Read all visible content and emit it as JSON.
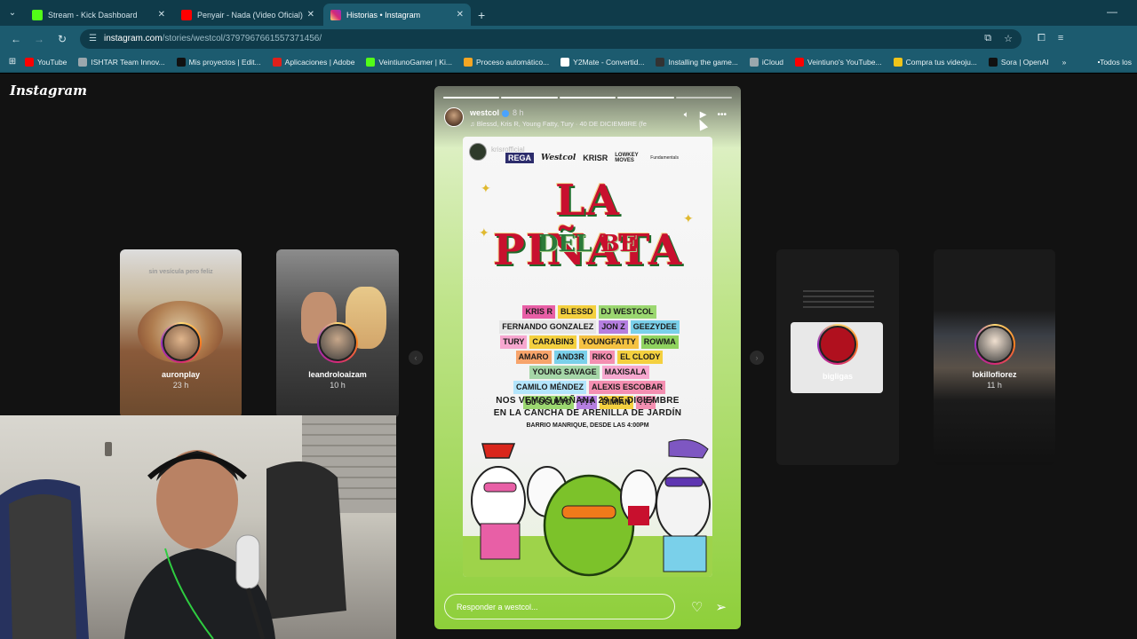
{
  "browser": {
    "tabs": [
      {
        "title": "Stream - Kick Dashboard",
        "color": "#53fc18",
        "active": false
      },
      {
        "title": "Penyair - Nada (Video Oficial) -",
        "color": "#ff0000",
        "active": false
      },
      {
        "title": "Historias • Instagram",
        "color": "#d62976",
        "active": true
      }
    ],
    "url_host": "instagram.com",
    "url_path": "/stories/westcol/3797967661557371456/",
    "bookmarks": [
      {
        "label": "YouTube",
        "color": "#ff0000"
      },
      {
        "label": "ISHTAR Team Innov...",
        "color": "#9aa7ad"
      },
      {
        "label": "Mis proyectos | Edit...",
        "color": "#111111"
      },
      {
        "label": "Aplicaciones | Adobe",
        "color": "#e0201b"
      },
      {
        "label": "VeintiunoGamer | Ki...",
        "color": "#53fc18"
      },
      {
        "label": "Proceso automático...",
        "color": "#f5a623"
      },
      {
        "label": "Y2Mate - Convertid...",
        "color": "#ffffff"
      },
      {
        "label": "Installing the game...",
        "color": "#333333"
      },
      {
        "label": "iCloud",
        "color": "#9aa7ad"
      },
      {
        "label": "Veintiuno's YouTube...",
        "color": "#ff0000"
      },
      {
        "label": "Compra tus videoju...",
        "color": "#f0c419"
      },
      {
        "label": "Sora | OpenAI",
        "color": "#111111"
      }
    ],
    "all_bookmarks": "Todos los"
  },
  "instagram": {
    "logo": "Instagram",
    "side_stories": [
      {
        "name": "auronplay",
        "time": "23 h"
      },
      {
        "name": "leandroloaizam",
        "time": "10 h"
      },
      {
        "name": "bigligas",
        "time": ""
      },
      {
        "name": "lokillofiorez",
        "time": "11 h"
      }
    ],
    "side_texts": {
      "auronplay_caption": "sin vesícula pero feliz"
    },
    "story": {
      "user": "westcol",
      "time_ago": "8 h",
      "music": "♫ Blessd, Kris R, Young Fatty, Tury · 40 DE DICIEMBRE (fe",
      "segments_total": 5,
      "segments_done": 4,
      "reply_placeholder": "Responder a westcol..."
    },
    "poster": {
      "user": "krisrofficial",
      "sponsors": [
        "REGA",
        "Westcol",
        "KRISR",
        "LOWKEY MOVES",
        "Fundamentals"
      ],
      "title_main": "LA PIÑATA",
      "title_sub_de": "DEL",
      "title_sub_be": "BE",
      "lineup": [
        {
          "name": "KRIS R",
          "bg": "#e85fa6"
        },
        {
          "name": "BLESSD",
          "bg": "#f4d03f"
        },
        {
          "name": "DJ WESTCOL",
          "bg": "#9bd770"
        },
        {
          "name": "FERNANDO GONZALEZ",
          "bg": "#e6e6e6"
        },
        {
          "name": "JON Z",
          "bg": "#b57ee0"
        },
        {
          "name": "GEEZYDEE",
          "bg": "#7ad0ea"
        },
        {
          "name": "TURY",
          "bg": "#f7a7cf"
        },
        {
          "name": "CARABIN3",
          "bg": "#f4d03f"
        },
        {
          "name": "YOUNGFATTY",
          "bg": "#f5c242"
        },
        {
          "name": "ROWMA",
          "bg": "#8fd35f"
        },
        {
          "name": "AMARO",
          "bg": "#f7a46b"
        },
        {
          "name": "AND3R",
          "bg": "#7ad0ea"
        },
        {
          "name": "RIKO",
          "bg": "#f48fb1"
        },
        {
          "name": "EL CLODY",
          "bg": "#f4d03f"
        },
        {
          "name": "YOUNG SAVAGE",
          "bg": "#a5d6a7"
        },
        {
          "name": "MAXISALA",
          "bg": "#f7a7cf"
        },
        {
          "name": "CAMILO MÉNDEZ",
          "bg": "#b3e5fc"
        },
        {
          "name": "ALEXIS ESCOBAR",
          "bg": "#f48fb1"
        },
        {
          "name": "DJ OCULTO",
          "bg": "#9bd770"
        },
        {
          "name": "???",
          "bg": "#b57ee0"
        },
        {
          "name": "DIMIAN",
          "bg": "#f4d03f"
        },
        {
          "name": "???",
          "bg": "#f48fb1"
        }
      ],
      "event_line1": "NOS VEMOS MAÑANA 29 DE DICIEMBRE",
      "event_line2": "EN LA CANCHA DE ARENILLA DE JARDÍN",
      "event_line3": "BARRIO MANRIQUE, DESDE LAS 4:00PM"
    }
  },
  "colors": {
    "chrome_dark": "#0f3b4a",
    "chrome_mid": "#1c5b6f",
    "ig_bg": "#121212"
  }
}
